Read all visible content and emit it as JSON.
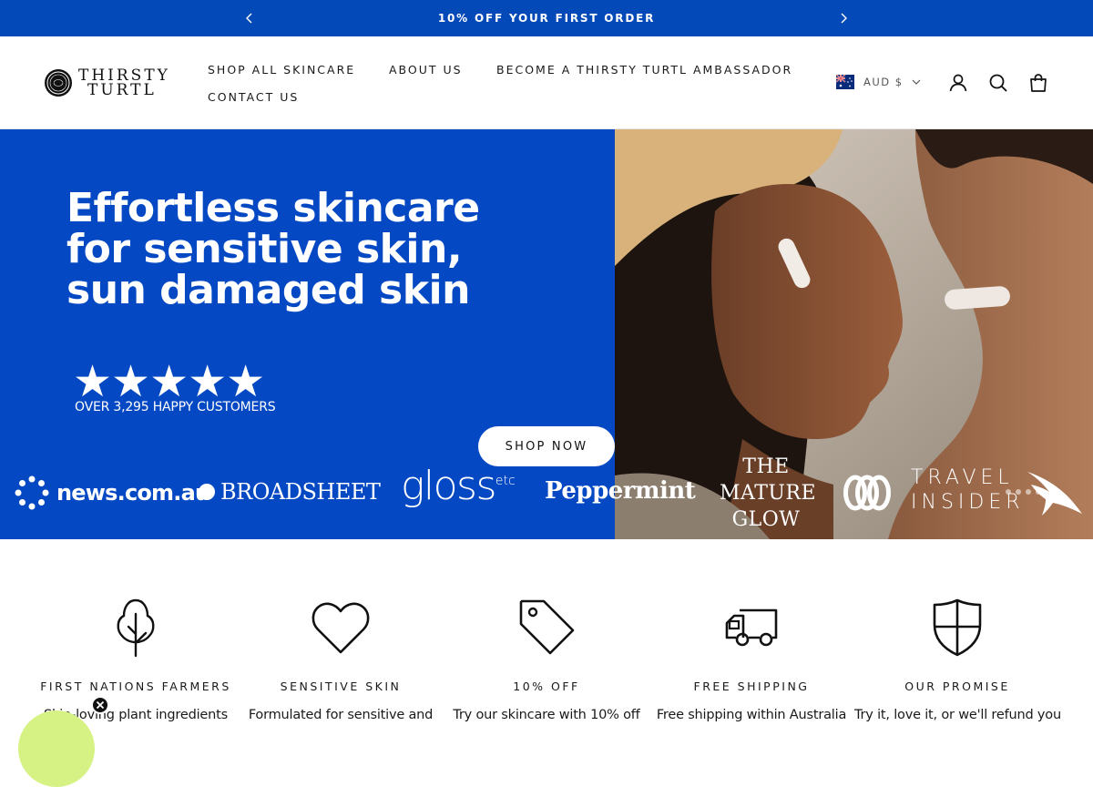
{
  "announcement": {
    "message": "10% OFF YOUR FIRST ORDER",
    "prev_icon": "chevron-left-icon",
    "next_icon": "chevron-right-icon",
    "background": "#0449b8"
  },
  "header": {
    "logo": {
      "line1": "THIRSTY",
      "line2": "TURTL"
    },
    "nav": [
      {
        "label": "SHOP ALL SKINCARE"
      },
      {
        "label": "ABOUT US"
      },
      {
        "label": "BECOME A THIRSTY TURTL AMBASSADOR"
      },
      {
        "label": "CONTACT US"
      }
    ],
    "currency": {
      "label": "AUD $",
      "flag": "australia-flag-icon"
    },
    "icons": [
      "account-icon",
      "search-icon",
      "cart-icon"
    ]
  },
  "hero": {
    "title_lines": [
      "Effortless skincare",
      "for sensitive skin,",
      "sun damaged skin"
    ],
    "stars": "★★★★★",
    "rating": 5,
    "reviews_text": "OVER 3,295 HAPPY CUSTOMERS",
    "cta": "SHOP NOW",
    "background": "#0449c3",
    "press": {
      "news": "news.com.au",
      "broadsheet": "BROADSHEET",
      "gloss": "gloss",
      "gloss_suffix": "etc",
      "peppermint": "Peppermint",
      "mature": [
        "THE",
        "MATURE",
        "GLOW"
      ],
      "travel": [
        "TRAVEL",
        "INSIDER"
      ]
    }
  },
  "features": [
    {
      "icon": "tree-icon",
      "title": "FIRST NATIONS FARMERS",
      "desc": "Skin-loving plant ingredients"
    },
    {
      "icon": "heart-icon",
      "title": "SENSITIVE SKIN",
      "desc": "Formulated for sensitive and"
    },
    {
      "icon": "tag-icon",
      "title": "10% OFF",
      "desc": "Try our skincare with 10% off"
    },
    {
      "icon": "delivery-truck-icon",
      "title": "FREE SHIPPING",
      "desc": "Free shipping within Australia"
    },
    {
      "icon": "shield-icon",
      "title": "OUR PROMISE",
      "desc": "Try it, love it, or we'll refund you"
    }
  ],
  "popup": {
    "close_icon": "close-icon",
    "accent": "#d6f285"
  }
}
